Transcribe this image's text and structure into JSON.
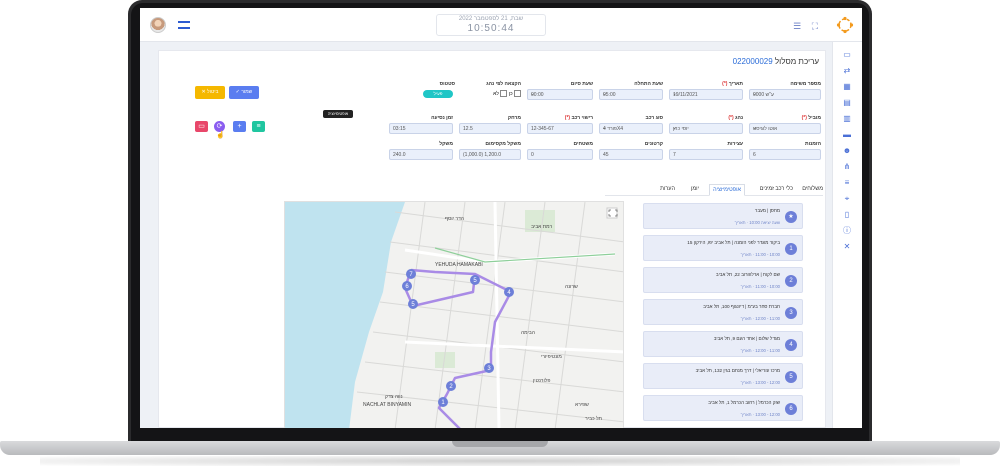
{
  "topbar": {
    "clock_date": "שבת, 21 לספטמבר 2022",
    "clock_time": "10:50:44"
  },
  "page": {
    "title": "עריכת מסלול",
    "order_id": "022000029"
  },
  "fields_row1": [
    {
      "label": "מספר משימה",
      "req": "",
      "value": "ע\"ש 0000"
    },
    {
      "label": "תאריך",
      "req": "(*)",
      "value": "19/11/2021"
    },
    {
      "label": "שעת התחלה",
      "req": "",
      "value": "05:00"
    },
    {
      "label": "שעת סיום",
      "req": "",
      "value": "00:00"
    },
    {
      "label": "הקצאה לפי נהג",
      "req": "",
      "value": ""
    },
    {
      "label": "סטטוס",
      "req": "",
      "value": "פעיל"
    }
  ],
  "yes_no": {
    "yes": "כן",
    "no": "לא"
  },
  "fields_row2": [
    {
      "label": "מוביל",
      "req": "(*)",
      "value": "אוטו לוגיסט"
    },
    {
      "label": "נהג",
      "req": "(*)",
      "value": "יוסי כהן"
    },
    {
      "label": "סוג רכב",
      "req": "",
      "value": "פורד 4X4"
    },
    {
      "label": "רישוי רכב",
      "req": "(*)",
      "value": "12-345-67"
    },
    {
      "label": "מרחק",
      "req": "",
      "value": "12.5"
    },
    {
      "label": "זמן נסיעה",
      "req": "",
      "value": "03:15"
    }
  ],
  "fields_row3": [
    {
      "label": "הזמנות",
      "value": "6"
    },
    {
      "label": "עצירות",
      "value": "7"
    },
    {
      "label": "קרטונים",
      "value": "45"
    },
    {
      "label": "משטחים",
      "value": "0"
    },
    {
      "label": "משקל מקסימום",
      "value": "(1,000.0) 1,200.0"
    },
    {
      "label": "משקל",
      "value": "240.0"
    }
  ],
  "buttons": {
    "save": "שמור",
    "cancel": "ביטול",
    "tooltip": "אופטימיזציה"
  },
  "tabs": [
    "משלוחים",
    "כלי רכב זמינים",
    "אופטימיזציה",
    "יומן",
    "הערות"
  ],
  "map_labels": {
    "yehuda": "YEHUDA HAMAKABI",
    "nachlat": "NACHLAT BINYAMIN",
    "florentin": "פלורנטין",
    "shapira": "שפירא",
    "neve_tzedek": "נווה צדק",
    "hadar": "הדר יוסף",
    "ramat": "רמת אביב",
    "habima": "הבימה",
    "sarona": "שרונה",
    "montefiore": "מונטיפיורי",
    "tel_kabir": "תל כביר"
  },
  "stops": [
    {
      "num": "★",
      "addr": "מחסן | מעבר",
      "meta": "שעה יציאה 10:00 · תאריך"
    },
    {
      "num": "1",
      "addr": "ביקור מוגדר לפני הזמנה | תל אביב יפו, הירקון 15",
      "meta": "10:00 - 11:00 · תאריך"
    },
    {
      "num": "2",
      "addr": "שם לקוח | ארלוזורוב 22, תל אביב",
      "meta": "10:00 - 11:00 · תאריך"
    },
    {
      "num": "3",
      "addr": "חברת סחר בע\"מ | דיזנגוף 100, תל אביב",
      "meta": "11:00 - 12:00 · תאריך"
    },
    {
      "num": "4",
      "addr": "מגדל שלום | אחד העם 9, תל אביב",
      "meta": "11:00 - 12:00 · תאריך"
    },
    {
      "num": "5",
      "addr": "מרכז עזריאלי | דרך מנחם בגין 132, תל אביב",
      "meta": "12:00 - 13:00 · תאריך"
    },
    {
      "num": "6",
      "addr": "שוק הכרמל | רחוב הכרמל 1, תל אביב",
      "meta": "12:00 - 13:00 · תאריך"
    }
  ]
}
